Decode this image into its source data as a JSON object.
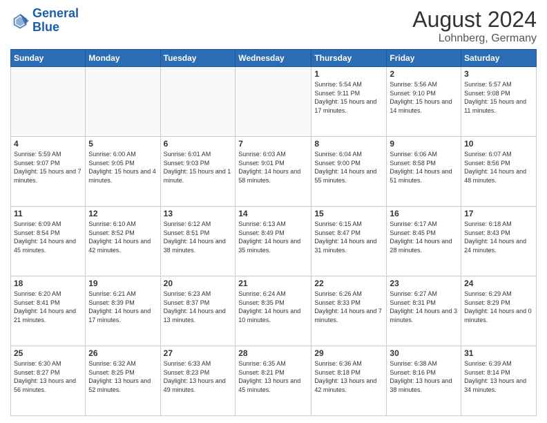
{
  "header": {
    "logo_line1": "General",
    "logo_line2": "Blue",
    "month_year": "August 2024",
    "location": "Lohnberg, Germany"
  },
  "days_of_week": [
    "Sunday",
    "Monday",
    "Tuesday",
    "Wednesday",
    "Thursday",
    "Friday",
    "Saturday"
  ],
  "weeks": [
    [
      {
        "day": "",
        "info": ""
      },
      {
        "day": "",
        "info": ""
      },
      {
        "day": "",
        "info": ""
      },
      {
        "day": "",
        "info": ""
      },
      {
        "day": "1",
        "info": "Sunrise: 5:54 AM\nSunset: 9:11 PM\nDaylight: 15 hours and 17 minutes."
      },
      {
        "day": "2",
        "info": "Sunrise: 5:56 AM\nSunset: 9:10 PM\nDaylight: 15 hours and 14 minutes."
      },
      {
        "day": "3",
        "info": "Sunrise: 5:57 AM\nSunset: 9:08 PM\nDaylight: 15 hours and 11 minutes."
      }
    ],
    [
      {
        "day": "4",
        "info": "Sunrise: 5:59 AM\nSunset: 9:07 PM\nDaylight: 15 hours and 7 minutes."
      },
      {
        "day": "5",
        "info": "Sunrise: 6:00 AM\nSunset: 9:05 PM\nDaylight: 15 hours and 4 minutes."
      },
      {
        "day": "6",
        "info": "Sunrise: 6:01 AM\nSunset: 9:03 PM\nDaylight: 15 hours and 1 minute."
      },
      {
        "day": "7",
        "info": "Sunrise: 6:03 AM\nSunset: 9:01 PM\nDaylight: 14 hours and 58 minutes."
      },
      {
        "day": "8",
        "info": "Sunrise: 6:04 AM\nSunset: 9:00 PM\nDaylight: 14 hours and 55 minutes."
      },
      {
        "day": "9",
        "info": "Sunrise: 6:06 AM\nSunset: 8:58 PM\nDaylight: 14 hours and 51 minutes."
      },
      {
        "day": "10",
        "info": "Sunrise: 6:07 AM\nSunset: 8:56 PM\nDaylight: 14 hours and 48 minutes."
      }
    ],
    [
      {
        "day": "11",
        "info": "Sunrise: 6:09 AM\nSunset: 8:54 PM\nDaylight: 14 hours and 45 minutes."
      },
      {
        "day": "12",
        "info": "Sunrise: 6:10 AM\nSunset: 8:52 PM\nDaylight: 14 hours and 42 minutes."
      },
      {
        "day": "13",
        "info": "Sunrise: 6:12 AM\nSunset: 8:51 PM\nDaylight: 14 hours and 38 minutes."
      },
      {
        "day": "14",
        "info": "Sunrise: 6:13 AM\nSunset: 8:49 PM\nDaylight: 14 hours and 35 minutes."
      },
      {
        "day": "15",
        "info": "Sunrise: 6:15 AM\nSunset: 8:47 PM\nDaylight: 14 hours and 31 minutes."
      },
      {
        "day": "16",
        "info": "Sunrise: 6:17 AM\nSunset: 8:45 PM\nDaylight: 14 hours and 28 minutes."
      },
      {
        "day": "17",
        "info": "Sunrise: 6:18 AM\nSunset: 8:43 PM\nDaylight: 14 hours and 24 minutes."
      }
    ],
    [
      {
        "day": "18",
        "info": "Sunrise: 6:20 AM\nSunset: 8:41 PM\nDaylight: 14 hours and 21 minutes."
      },
      {
        "day": "19",
        "info": "Sunrise: 6:21 AM\nSunset: 8:39 PM\nDaylight: 14 hours and 17 minutes."
      },
      {
        "day": "20",
        "info": "Sunrise: 6:23 AM\nSunset: 8:37 PM\nDaylight: 14 hours and 13 minutes."
      },
      {
        "day": "21",
        "info": "Sunrise: 6:24 AM\nSunset: 8:35 PM\nDaylight: 14 hours and 10 minutes."
      },
      {
        "day": "22",
        "info": "Sunrise: 6:26 AM\nSunset: 8:33 PM\nDaylight: 14 hours and 7 minutes."
      },
      {
        "day": "23",
        "info": "Sunrise: 6:27 AM\nSunset: 8:31 PM\nDaylight: 14 hours and 3 minutes."
      },
      {
        "day": "24",
        "info": "Sunrise: 6:29 AM\nSunset: 8:29 PM\nDaylight: 14 hours and 0 minutes."
      }
    ],
    [
      {
        "day": "25",
        "info": "Sunrise: 6:30 AM\nSunset: 8:27 PM\nDaylight: 13 hours and 56 minutes."
      },
      {
        "day": "26",
        "info": "Sunrise: 6:32 AM\nSunset: 8:25 PM\nDaylight: 13 hours and 52 minutes."
      },
      {
        "day": "27",
        "info": "Sunrise: 6:33 AM\nSunset: 8:23 PM\nDaylight: 13 hours and 49 minutes."
      },
      {
        "day": "28",
        "info": "Sunrise: 6:35 AM\nSunset: 8:21 PM\nDaylight: 13 hours and 45 minutes."
      },
      {
        "day": "29",
        "info": "Sunrise: 6:36 AM\nSunset: 8:18 PM\nDaylight: 13 hours and 42 minutes."
      },
      {
        "day": "30",
        "info": "Sunrise: 6:38 AM\nSunset: 8:16 PM\nDaylight: 13 hours and 38 minutes."
      },
      {
        "day": "31",
        "info": "Sunrise: 6:39 AM\nSunset: 8:14 PM\nDaylight: 13 hours and 34 minutes."
      }
    ]
  ]
}
